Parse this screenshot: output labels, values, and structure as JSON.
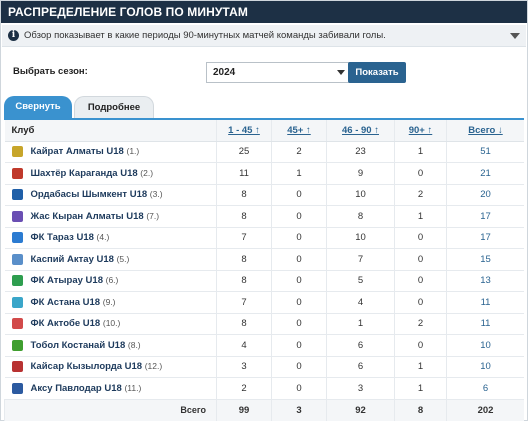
{
  "title": "РАСПРЕДЕЛЕНИЕ ГОЛОВ ПО МИНУТАМ",
  "info": {
    "icon": "info-icon",
    "text": "Обзор показывает в какие периоды 90-минутных матчей команды забивали голы."
  },
  "season": {
    "label": "Выбрать сезон:",
    "selected": "2024",
    "button": "Показать"
  },
  "tabs": {
    "active": "Свернуть",
    "inactive": "Подробнее"
  },
  "table": {
    "headers": {
      "club": "Клуб",
      "p1": "1 - 45 ↑",
      "p1x": "45+ ↑",
      "p2": "46 - 90 ↑",
      "p2x": "90+ ↑",
      "total": "Всего ↓"
    },
    "rows": [
      {
        "name": "Кайрат Алматы U18",
        "rank": "(1.)",
        "color": "#c7a52a",
        "p1": "25",
        "p1x": "2",
        "p2": "23",
        "p2x": "1",
        "total": "51"
      },
      {
        "name": "Шахтёр Караганда U18",
        "rank": "(2.)",
        "color": "#c0392b",
        "p1": "11",
        "p1x": "1",
        "p2": "9",
        "p2x": "0",
        "total": "21"
      },
      {
        "name": "Ордабасы Шымкент U18",
        "rank": "(3.)",
        "color": "#1f5fa8",
        "p1": "8",
        "p1x": "0",
        "p2": "10",
        "p2x": "2",
        "total": "20"
      },
      {
        "name": "Жас Кыран Алматы U18",
        "rank": "(7.)",
        "color": "#6a4fb3",
        "p1": "8",
        "p1x": "0",
        "p2": "8",
        "p2x": "1",
        "total": "17"
      },
      {
        "name": "ФК Тараз U18",
        "rank": "(4.)",
        "color": "#2b7bd1",
        "p1": "7",
        "p1x": "0",
        "p2": "10",
        "p2x": "0",
        "total": "17"
      },
      {
        "name": "Каспий Актау U18",
        "rank": "(5.)",
        "color": "#5a8fc9",
        "p1": "8",
        "p1x": "0",
        "p2": "7",
        "p2x": "0",
        "total": "15"
      },
      {
        "name": "ФК Атырау U18",
        "rank": "(6.)",
        "color": "#2e9e4f",
        "p1": "8",
        "p1x": "0",
        "p2": "5",
        "p2x": "0",
        "total": "13"
      },
      {
        "name": "ФК Астана U18",
        "rank": "(9.)",
        "color": "#3aa6c9",
        "p1": "7",
        "p1x": "0",
        "p2": "4",
        "p2x": "0",
        "total": "11"
      },
      {
        "name": "ФК Актобе U18",
        "rank": "(10.)",
        "color": "#d24a4a",
        "p1": "8",
        "p1x": "0",
        "p2": "1",
        "p2x": "2",
        "total": "11"
      },
      {
        "name": "Тобол Костанай U18",
        "rank": "(8.)",
        "color": "#3f9e2f",
        "p1": "4",
        "p1x": "0",
        "p2": "6",
        "p2x": "0",
        "total": "10"
      },
      {
        "name": "Кайсар Кызылорда U18",
        "rank": "(12.)",
        "color": "#b83232",
        "p1": "3",
        "p1x": "0",
        "p2": "6",
        "p2x": "1",
        "total": "10"
      },
      {
        "name": "Аксу Павлодар U18",
        "rank": "(11.)",
        "color": "#2c5aa0",
        "p1": "2",
        "p1x": "0",
        "p2": "3",
        "p2x": "1",
        "total": "6"
      }
    ],
    "footer": {
      "label": "Всего",
      "p1": "99",
      "p1x": "3",
      "p2": "92",
      "p2x": "8",
      "total": "202"
    }
  }
}
